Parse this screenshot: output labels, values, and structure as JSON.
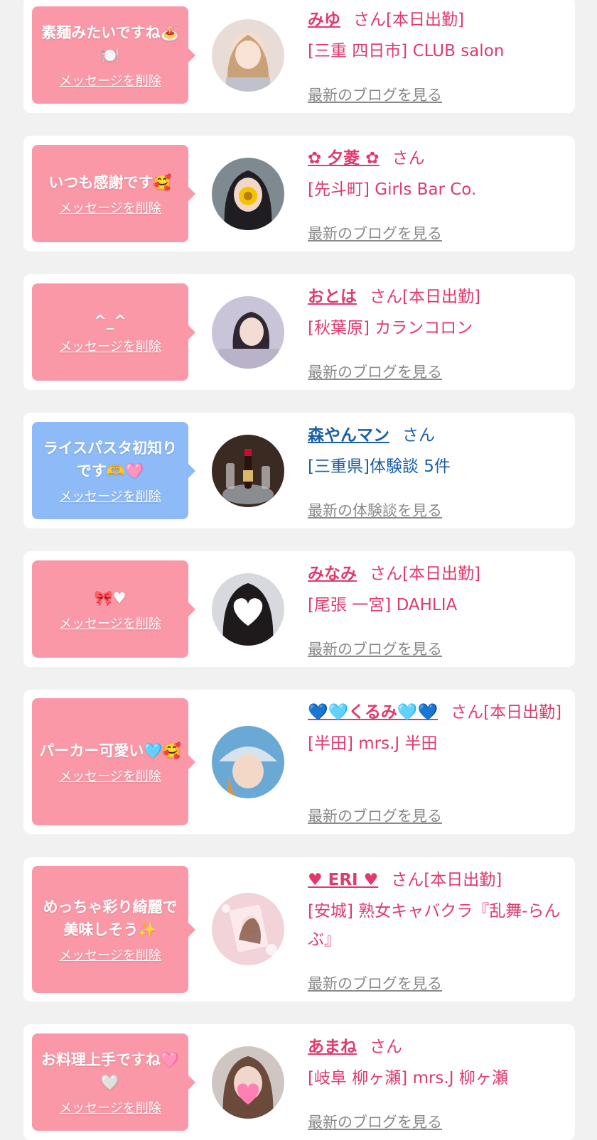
{
  "delete_label": "メッセージを削除",
  "colors": {
    "pink_bubble": "#fb98a8",
    "blue_bubble": "#8ebaf7",
    "name_pink": "#e03a6c",
    "name_blue": "#1a5fa8",
    "link_gray": "#8a8a8a"
  },
  "items": [
    {
      "message": "素麺みたいですね🍝🍽️",
      "name": "みゆ",
      "suffix": "さん[本日出勤]",
      "shop": "[三重 四日市] CLUB salon",
      "link": "最新のブログを見る"
    },
    {
      "message": "いつも感謝です🥰",
      "name": "✿ 夕菱 ✿",
      "suffix": "さん",
      "shop": "[先斗町] Girls Bar Co.",
      "link": "最新のブログを見る"
    },
    {
      "message": "^_^",
      "name": "おとは",
      "suffix": "さん[本日出勤]",
      "shop": "[秋葉原] カランコロン",
      "link": "最新のブログを見る"
    },
    {
      "message": "ライスパスタ初知りです🫶🩷",
      "name": "森やんマン",
      "suffix": "さん",
      "shop": "[三重県]体験談 5件",
      "link": "最新の体験談を見る"
    },
    {
      "message": "🎀♥",
      "name": "みなみ",
      "suffix": "さん[本日出勤]",
      "shop": "[尾張 一宮] DAHLIA",
      "link": "最新のブログを見る"
    },
    {
      "message": "パーカー可愛い🩵🥰",
      "name": "💙🩵くるみ🩵💙",
      "suffix": "さん[本日出勤]",
      "shop": "[半田] mrs.J 半田",
      "link": "最新のブログを見る"
    },
    {
      "message": "めっちゃ彩り綺麗で美味しそう✨",
      "name": "♥ ERI ♥",
      "suffix": "さん[本日出勤]",
      "shop": "[安城] 熟女キャバクラ『乱舞-らんぶ』",
      "link": "最新のブログを見る"
    },
    {
      "message": "お料理上手ですね🩷🤍",
      "name": "あまね",
      "suffix": "さん",
      "shop": "[岐阜 柳ヶ瀬] mrs.J 柳ヶ瀬",
      "link": "最新のブログを見る"
    }
  ]
}
